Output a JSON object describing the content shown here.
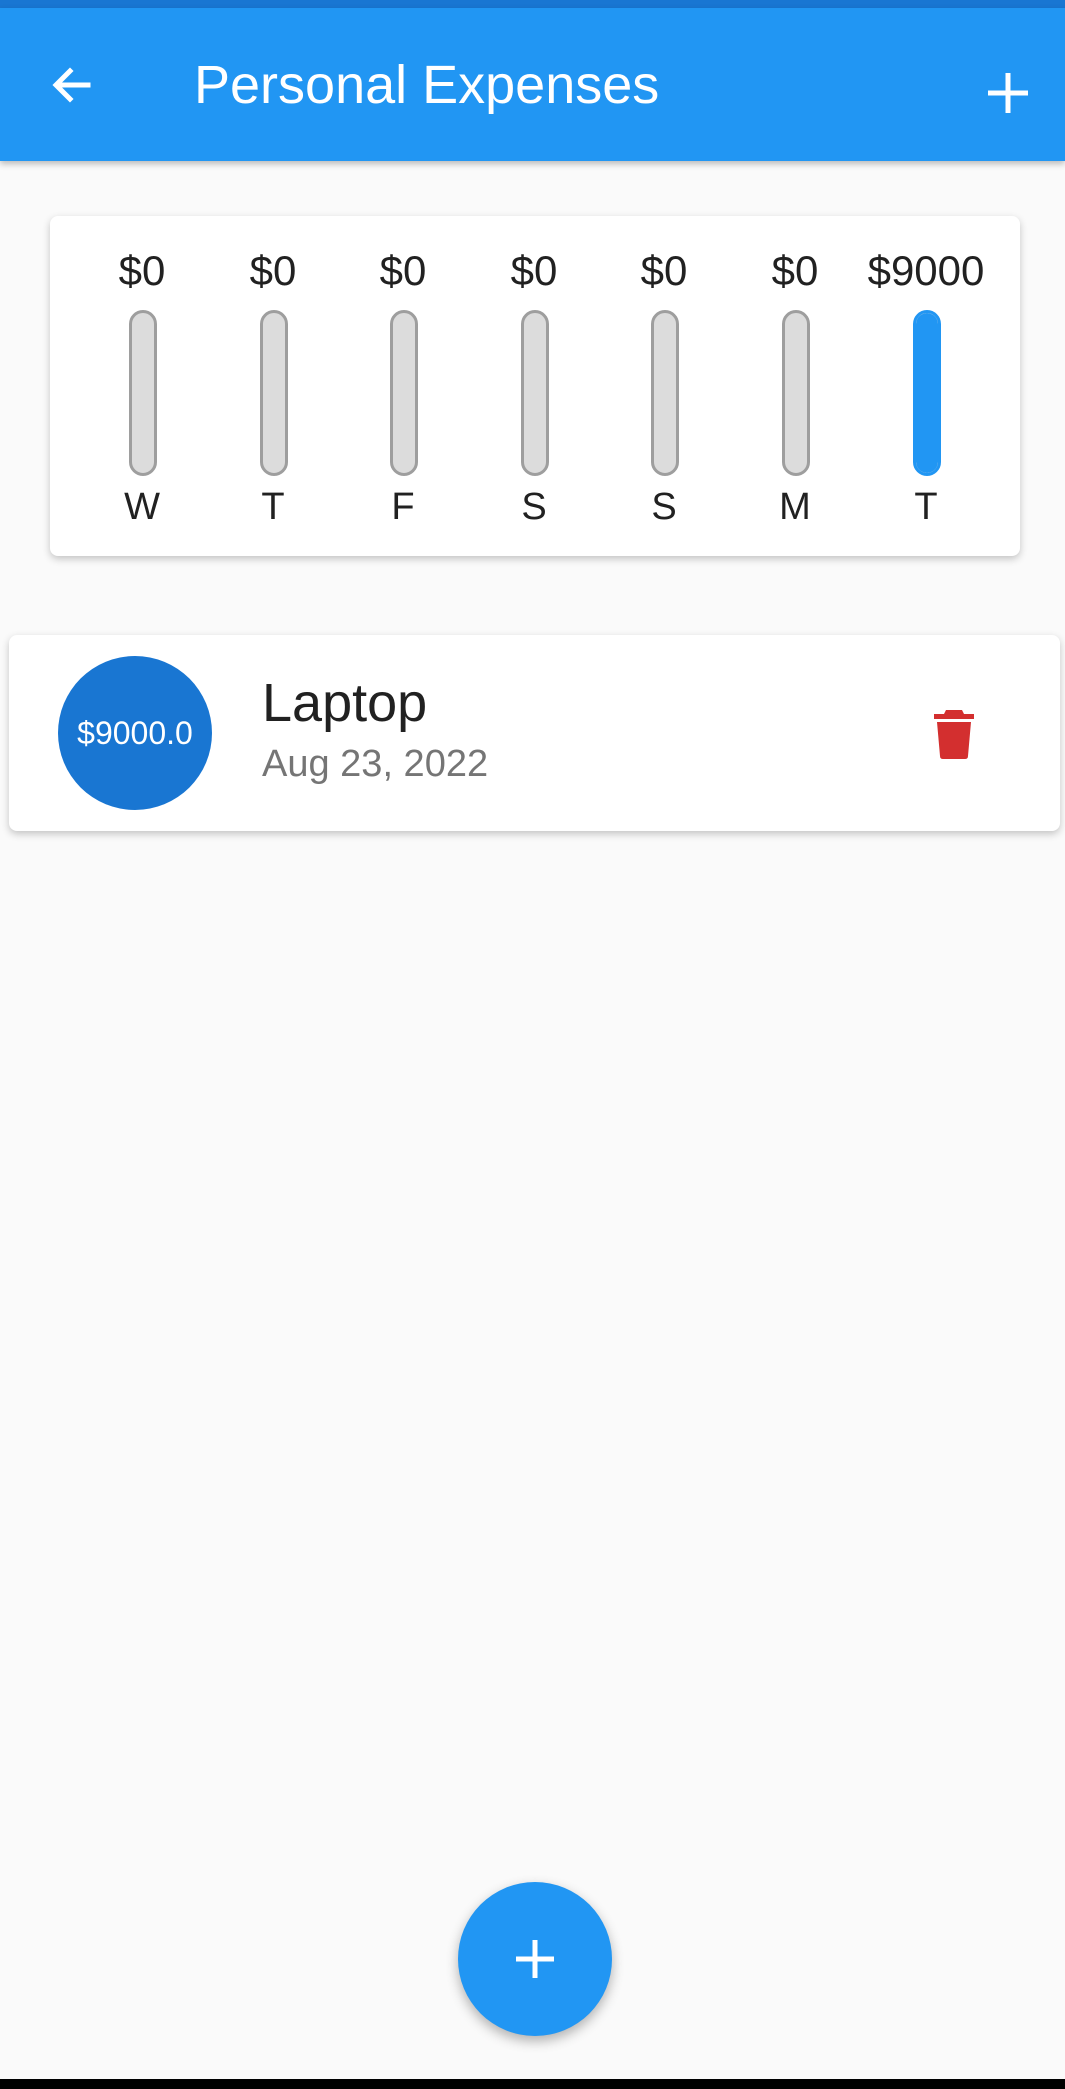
{
  "app_bar": {
    "title": "Personal Expenses",
    "back_icon": "arrow-left-icon",
    "add_icon": "plus-icon",
    "color": "#2196f3"
  },
  "chart": {
    "bars": [
      {
        "day": "W",
        "amount": "$0",
        "fraction": 0
      },
      {
        "day": "T",
        "amount": "$0",
        "fraction": 0
      },
      {
        "day": "F",
        "amount": "$0",
        "fraction": 0
      },
      {
        "day": "S",
        "amount": "$0",
        "fraction": 0
      },
      {
        "day": "S",
        "amount": "$0",
        "fraction": 0
      },
      {
        "day": "M",
        "amount": "$0",
        "fraction": 0
      },
      {
        "day": "T",
        "amount": "$9000",
        "fraction": 1
      }
    ],
    "fill_color": "#2196f3",
    "empty_color": "#dcdcdc"
  },
  "transactions": [
    {
      "amount": "$9000.0",
      "title": "Laptop",
      "date": "Aug 23, 2022",
      "delete_icon": "trash-icon",
      "delete_color": "#d32f2f"
    }
  ],
  "fab": {
    "icon": "plus-icon",
    "color": "#2196f3"
  }
}
